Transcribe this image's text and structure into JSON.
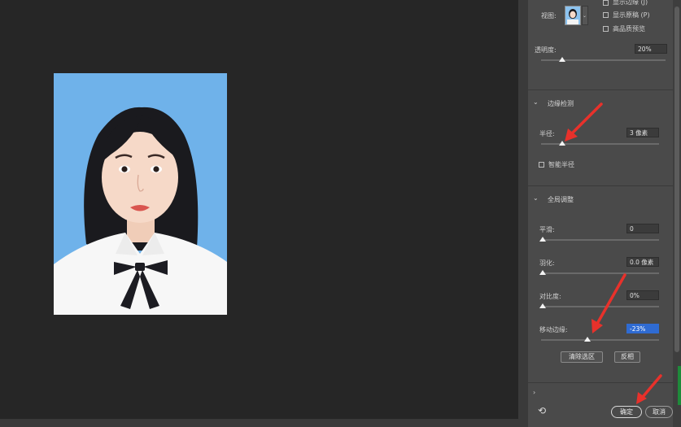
{
  "view_options": {
    "view_label": "视图:",
    "show_edge": "显示边缘 (J)",
    "show_original": "显示原稿 (P)",
    "hq_preview": "高品质预览"
  },
  "transparency": {
    "label": "透明度:",
    "value": "20%",
    "level_percent": 20
  },
  "edge_detection": {
    "title": "边缘检测",
    "radius_label": "半径:",
    "radius_value": "3 像素",
    "smart_radius_label": "智能半径"
  },
  "global_refinements": {
    "title": "全局调整",
    "smooth_label": "平滑:",
    "smooth_value": "0",
    "feather_label": "羽化:",
    "feather_value": "0.0 像素",
    "contrast_label": "对比度:",
    "contrast_value": "0%",
    "shift_edge_label": "移动边缘:",
    "shift_edge_value": "-23%",
    "clear_selection_button": "清除选区",
    "invert_button": "反相"
  },
  "footer": {
    "reset_icon": "reset-icon",
    "ok_button": "确定",
    "cancel_button": "取消"
  },
  "colors": {
    "canvas_bg": "#262626",
    "panel_bg": "#4a4a4a",
    "photo_bg": "#6fb2ea",
    "selection_blue": "#2f6bd2",
    "annotation_red": "#e8312b"
  }
}
